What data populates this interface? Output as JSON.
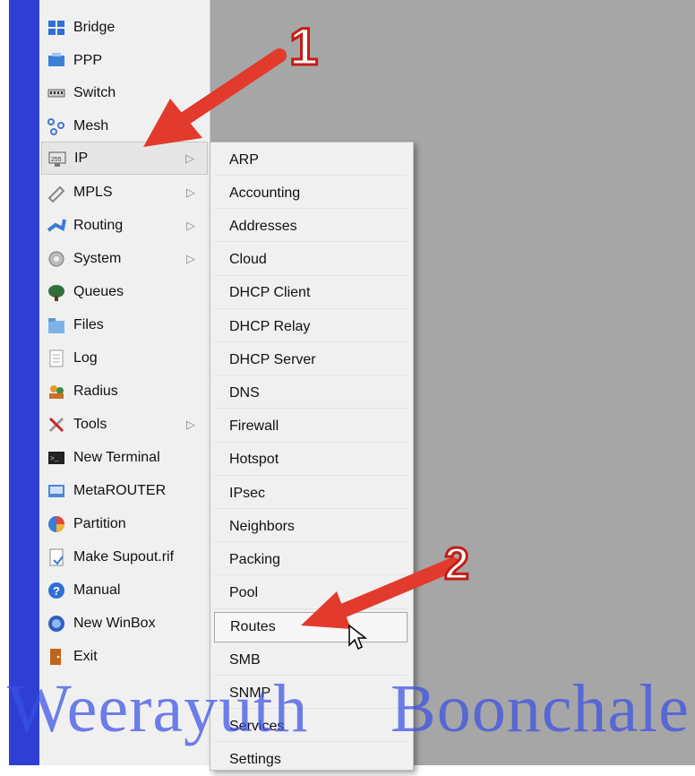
{
  "left_menu": {
    "items": [
      {
        "label": "Bridge",
        "icon": "bridge-icon",
        "has_submenu": false
      },
      {
        "label": "PPP",
        "icon": "ppp-icon",
        "has_submenu": false
      },
      {
        "label": "Switch",
        "icon": "switch-icon",
        "has_submenu": false
      },
      {
        "label": "Mesh",
        "icon": "mesh-icon",
        "has_submenu": false
      },
      {
        "label": "IP",
        "icon": "ip-icon",
        "has_submenu": true,
        "selected": true
      },
      {
        "label": "MPLS",
        "icon": "mpls-icon",
        "has_submenu": true
      },
      {
        "label": "Routing",
        "icon": "routing-icon",
        "has_submenu": true
      },
      {
        "label": "System",
        "icon": "system-icon",
        "has_submenu": true
      },
      {
        "label": "Queues",
        "icon": "queues-icon",
        "has_submenu": false
      },
      {
        "label": "Files",
        "icon": "files-icon",
        "has_submenu": false
      },
      {
        "label": "Log",
        "icon": "log-icon",
        "has_submenu": false
      },
      {
        "label": "Radius",
        "icon": "radius-icon",
        "has_submenu": false
      },
      {
        "label": "Tools",
        "icon": "tools-icon",
        "has_submenu": true
      },
      {
        "label": "New Terminal",
        "icon": "terminal-icon",
        "has_submenu": false
      },
      {
        "label": "MetaROUTER",
        "icon": "metarouter-icon",
        "has_submenu": false
      },
      {
        "label": "Partition",
        "icon": "partition-icon",
        "has_submenu": false
      },
      {
        "label": "Make Supout.rif",
        "icon": "supout-icon",
        "has_submenu": false
      },
      {
        "label": "Manual",
        "icon": "help-icon",
        "has_submenu": false
      },
      {
        "label": "New WinBox",
        "icon": "winbox-icon",
        "has_submenu": false
      },
      {
        "label": "Exit",
        "icon": "exit-icon",
        "has_submenu": false
      }
    ]
  },
  "ip_submenu": {
    "items": [
      "ARP",
      "Accounting",
      "Addresses",
      "Cloud",
      "DHCP Client",
      "DHCP Relay",
      "DHCP Server",
      "DNS",
      "Firewall",
      "Hotspot",
      "IPsec",
      "Neighbors",
      "Packing",
      "Pool",
      "Routes",
      "SMB",
      "SNMP",
      "Services",
      "Settings"
    ],
    "hovered": "Routes"
  },
  "annotations": {
    "step1": "1",
    "step2": "2"
  },
  "watermark": {
    "first": "Weerayuth",
    "last": "Boonchale"
  },
  "colors": {
    "arrow": "#e23a2c",
    "strip": "#2f3fd4",
    "watermark": "#3a50e6",
    "work_area": "#a6a6a6"
  }
}
